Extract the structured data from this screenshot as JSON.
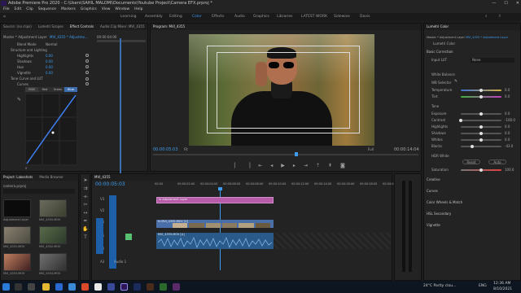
{
  "titlebar": {
    "title": "Adobe Premiere Pro 2020 - C:\\Users\\SAHIL MALOMI\\Documents\\Youtube Project\\Camera EFX.prproj *",
    "minimize": "—",
    "maximize": "☐",
    "close": "✕"
  },
  "menu": [
    "File",
    "Edit",
    "Clip",
    "Sequence",
    "Markers",
    "Graphics",
    "View",
    "Window",
    "Help"
  ],
  "workspaces": [
    "Learning",
    "Assembly",
    "Editing",
    "Color",
    "Effects",
    "Audio",
    "Graphics",
    "Libraries",
    "LATEST WORK",
    "Sidewise",
    "Davis"
  ],
  "effect_controls": {
    "tabs": [
      "Source: (no clips)",
      "Lumetri Scopes",
      "Effect Controls",
      "Audio Clip Mixer: MVI_4355"
    ],
    "master": "Master * Adjustment Layer",
    "clip": "MVI_4355 * Adjustme...",
    "timecode": "00:00:04:00",
    "blend_label": "Blend Mode",
    "blend_value": "Normal",
    "section_tone": "Structure and Lighting",
    "params": [
      {
        "name": "Highlights",
        "value": "0.00"
      },
      {
        "name": "Shadows",
        "value": "0.00"
      },
      {
        "name": "Hue",
        "value": "0.00"
      },
      {
        "name": "Vignette",
        "value": "0.00"
      }
    ],
    "curve_section": "Tone Curve and LUT",
    "curves_label": "Curves",
    "channels": [
      "RGB",
      "Red",
      "Green",
      "Blue"
    ],
    "levels": [
      "0",
      "0",
      "0",
      "0",
      "0"
    ]
  },
  "program": {
    "title": "Program: MVI_4355",
    "timecode_left": "00:00:05:03",
    "fit": "Fit",
    "quality": "Full",
    "timecode_right": "00:00:14:04"
  },
  "project": {
    "tabs": [
      "Project: Lakeshots",
      "Media Browser"
    ],
    "file": "camera.prproj",
    "items": [
      {
        "label": "Adjustment Layer",
        "duration": "5:00"
      },
      {
        "label": "MVI_4355.MOV",
        "duration": "14:04"
      },
      {
        "label": "MVI_4351.MOV",
        "duration": "9:12"
      },
      {
        "label": "MVI_4352.MOV",
        "duration": "11:02"
      },
      {
        "label": "MVI_4353.MOV",
        "duration": "8:20"
      },
      {
        "label": "MVI_4354.MOV",
        "duration": "7:15"
      }
    ]
  },
  "timeline": {
    "tab": "MVI_4355",
    "timecode": "00:00:05:03",
    "ruler": [
      "00:00",
      "00:00:02:00",
      "00:00:04:00",
      "00:00:06:00",
      "00:00:08:00",
      "00:00:10:00",
      "00:00:12:00",
      "00:00:14:00",
      "00:00:16:00",
      "00:00:18:00",
      "00:00:20:00"
    ],
    "tracks": [
      "V3",
      "V2",
      "V1",
      "A1",
      "A2",
      "A3"
    ],
    "clips": {
      "adjustment": "fx  Adjustment Layer",
      "video": "fx  MVI_4355.MOV [V]",
      "audio": "MVI_4355.MOV [A]"
    },
    "audio_label": "Audio 1"
  },
  "lumetri": {
    "tab": "Lumetri Color",
    "master": "Master * Adjustment Layer",
    "clip": "MVI_4355 * Adjustment Layer",
    "fx_label": "Lumetri Color",
    "basic": "Basic Correction",
    "input_lut_label": "Input LUT",
    "input_lut": "None",
    "white_balance": "White Balance",
    "wb_selector": "WB Selector",
    "temperature": {
      "label": "Temperature",
      "value": "0.0"
    },
    "tint": {
      "label": "Tint",
      "value": "0.0"
    },
    "tone": "Tone",
    "tone_rows": [
      {
        "label": "Exposure",
        "value": "0.0",
        "pos": 0.5
      },
      {
        "label": "Contrast",
        "value": "-100.0",
        "pos": 0.0
      },
      {
        "label": "Highlights",
        "value": "0.0",
        "pos": 0.5
      },
      {
        "label": "Shadows",
        "value": "0.0",
        "pos": 0.5
      },
      {
        "label": "Whites",
        "value": "0.0",
        "pos": 0.5
      },
      {
        "label": "Blacks",
        "value": "-43.0",
        "pos": 0.28
      }
    ],
    "hdr": "HDR White",
    "reset": "Reset",
    "auto": "Auto",
    "saturation": {
      "label": "Saturation",
      "value": "100.0"
    },
    "sections": [
      "Creative",
      "Curves",
      "Color Wheels & Match",
      "HSL Secondary",
      "Vignette"
    ]
  },
  "taskbar": {
    "weather": "24°C  Partly clou...",
    "time": "12:36 AM",
    "date": "8/10/2021",
    "lang": "ENG"
  }
}
